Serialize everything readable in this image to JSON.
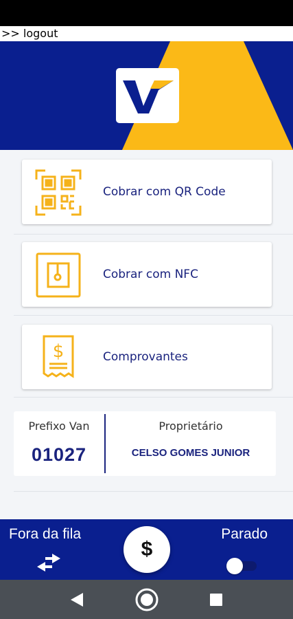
{
  "top_link": {
    "label": ">> logout"
  },
  "menu": [
    {
      "label": "Cobrar com QR Code",
      "icon": "qr-code-icon"
    },
    {
      "label": "Cobrar com NFC",
      "icon": "nfc-icon"
    },
    {
      "label": "Comprovantes",
      "icon": "receipt-icon"
    }
  ],
  "info": {
    "prefix_label": "Prefixo Van",
    "prefix_value": "01027",
    "owner_label": "Proprietário",
    "owner_value": "CELSO GOMES JUNIOR"
  },
  "bottom": {
    "queue_label": "Fora da fila",
    "fab_label": "$",
    "status_label": "Parado",
    "toggle_on": false
  },
  "colors": {
    "primary": "#0a1f8f",
    "accent": "#fbb917",
    "text_primary": "#1a237e"
  }
}
